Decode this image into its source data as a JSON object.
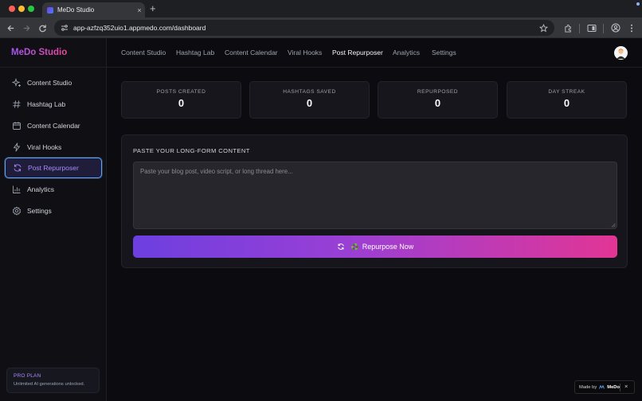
{
  "browser": {
    "tab_title": "MeDo Studio",
    "tab_close": "×",
    "new_tab": "+",
    "url": "app-azfzq352uio1.appmedo.com/dashboard"
  },
  "app": {
    "logo": "MeDo Studio",
    "accent_color": "#a855f7",
    "gradient_start": "#6d3fe0",
    "gradient_end": "#e23595"
  },
  "sidebar": {
    "items": [
      {
        "label": "Content Studio",
        "icon": "sparkles-icon"
      },
      {
        "label": "Hashtag Lab",
        "icon": "hash-icon"
      },
      {
        "label": "Content Calendar",
        "icon": "calendar-icon"
      },
      {
        "label": "Viral Hooks",
        "icon": "lightning-icon"
      },
      {
        "label": "Post Repurposer",
        "icon": "refresh-icon",
        "active": true
      },
      {
        "label": "Analytics",
        "icon": "bar-chart-icon"
      },
      {
        "label": "Settings",
        "icon": "gear-icon"
      }
    ],
    "plan": {
      "title": "PRO PLAN",
      "subtitle": "Unlimited AI generations unlocked."
    }
  },
  "topnav": {
    "links": [
      "Content Studio",
      "Hashtag Lab",
      "Content Calendar",
      "Viral Hooks",
      "Post Repurposer",
      "Analytics",
      "Settings"
    ],
    "active": "Post Repurposer"
  },
  "stats": [
    {
      "label": "POSTS CREATED",
      "value": "0"
    },
    {
      "label": "HASHTAGS SAVED",
      "value": "0"
    },
    {
      "label": "REPURPOSED",
      "value": "0"
    },
    {
      "label": "DAY STREAK",
      "value": "0"
    }
  ],
  "repurposer": {
    "title": "PASTE YOUR LONG-FORM CONTENT",
    "input_value": "",
    "placeholder": "Paste your blog post, video script, or long thread here...",
    "button_emoji": "♻️",
    "button_label": "Repurpose Now"
  },
  "badge": {
    "made_by": "Made by",
    "brand": "MeDo",
    "close": "×"
  }
}
